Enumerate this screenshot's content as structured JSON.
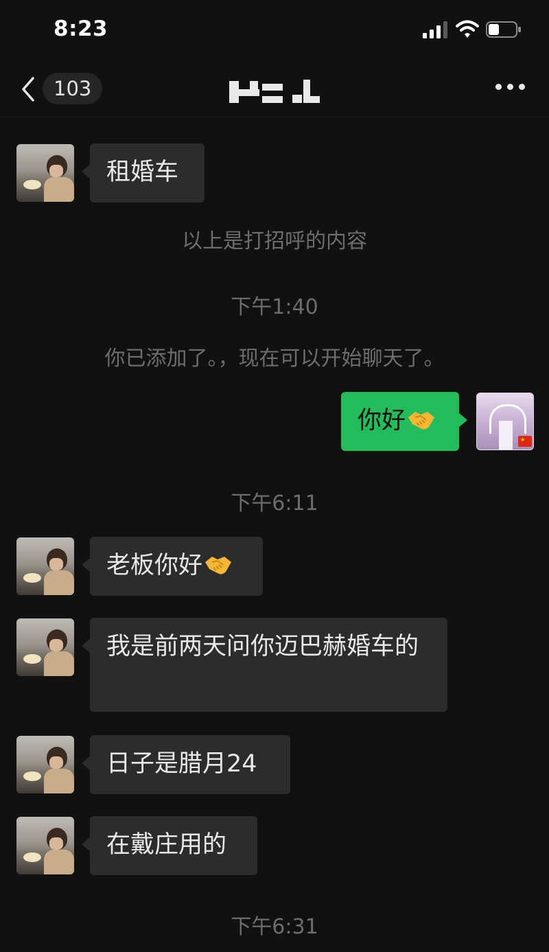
{
  "status_bar": {
    "time": "8:23"
  },
  "nav": {
    "unread_count": "103",
    "icons": [
      "back-chevron-icon",
      "more-icon"
    ]
  },
  "messages": [
    {
      "side": "in",
      "text": "租婚车"
    },
    {
      "side": "in",
      "text": "老板你好"
    },
    {
      "side": "in",
      "text": "我是前两天问你迈巴赫婚车的"
    },
    {
      "side": "in",
      "text": "日子是腊月24"
    },
    {
      "side": "in",
      "text": "在戴庄用的"
    }
  ],
  "my_message": {
    "side": "out",
    "text": "你好"
  },
  "system": {
    "greeting_note": "以上是打招呼的内容",
    "time_1": "下午1:40",
    "added_note": "你已添加了。，现在可以开始聊天了。",
    "time_2": "下午6:11",
    "time_3": "下午6:31"
  },
  "colors": {
    "background": "#111111",
    "bubble_in": "#2c2c2c",
    "bubble_out": "#21bd5b"
  }
}
